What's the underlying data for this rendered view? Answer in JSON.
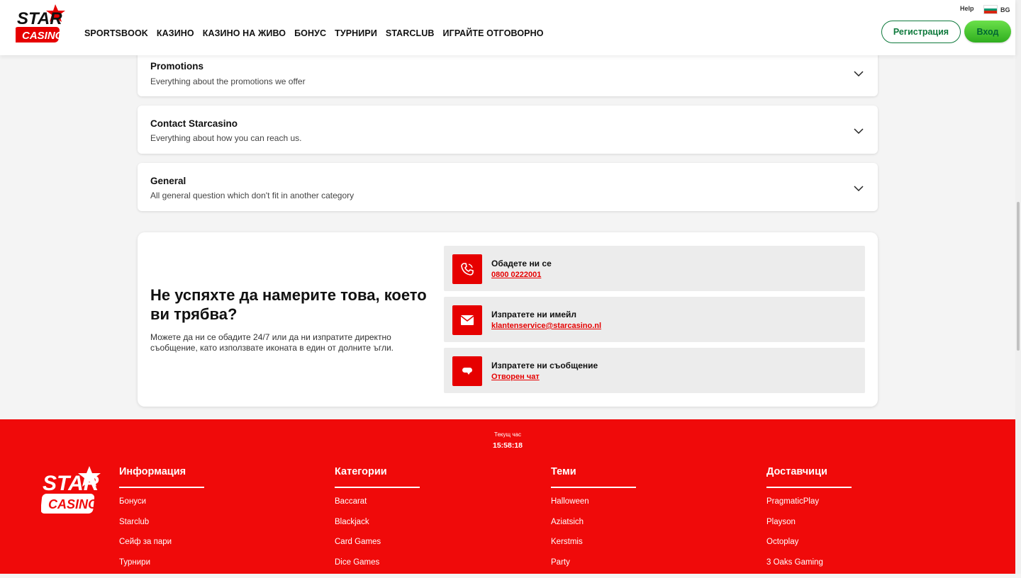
{
  "header": {
    "logo_top": "STAR",
    "logo_bottom": "CASINO",
    "nav": [
      "SPORTSBOOK",
      "КАЗИНО",
      "КАЗИНО НА ЖИВО",
      "БОНУС",
      "ТУРНИРИ",
      "STARCLUB",
      "ИГРАЙТЕ ОТГОВОРНО"
    ],
    "help": "Help",
    "lang": "BG",
    "register": "Регистрация",
    "login": "Вход"
  },
  "faq": [
    {
      "title": "Promotions",
      "subtitle": "Everything about the promotions we offer"
    },
    {
      "title": "Contact Starcasino",
      "subtitle": "Everything about how you can reach us."
    },
    {
      "title": "General",
      "subtitle": "All general question which don't fit in another category"
    }
  ],
  "contact": {
    "heading": "Не успяхте да намерите това, което ви трябва?",
    "text": "Можете да ни се обадите 24/7 или да ни изпратите директно съобщение, като използвате иконата в един от долните ъгли.",
    "options": [
      {
        "icon": "phone-icon",
        "title": "Обадете ни се",
        "link": "0800 0222001"
      },
      {
        "icon": "mail-icon",
        "title": "Изпратете ни имейл",
        "link": "klantenservice@starcasino.nl"
      },
      {
        "icon": "chat-icon",
        "title": "Изпратете ни съобщение",
        "link": "Отворен чат"
      }
    ]
  },
  "footer": {
    "time_label": "Текущ час",
    "time_value": "15:58:18",
    "columns": [
      {
        "title": "Информация",
        "links": [
          "Бонуси",
          "Starclub",
          "Сейф за пари",
          "Турнири"
        ]
      },
      {
        "title": "Категории",
        "links": [
          "Baccarat",
          "Blackjack",
          "Card Games",
          "Dice Games"
        ]
      },
      {
        "title": "Теми",
        "links": [
          "Halloween",
          "Aziatsich",
          "Kerstmis",
          "Party"
        ]
      },
      {
        "title": "Доставчици",
        "links": [
          "PragmaticPlay",
          "Playson",
          "Octoplay",
          "3 Oaks Gaming"
        ]
      }
    ]
  },
  "colors": {
    "brand_red": "#e60000",
    "footer_red": "#f00a0a",
    "green": "#0f7a3d"
  }
}
